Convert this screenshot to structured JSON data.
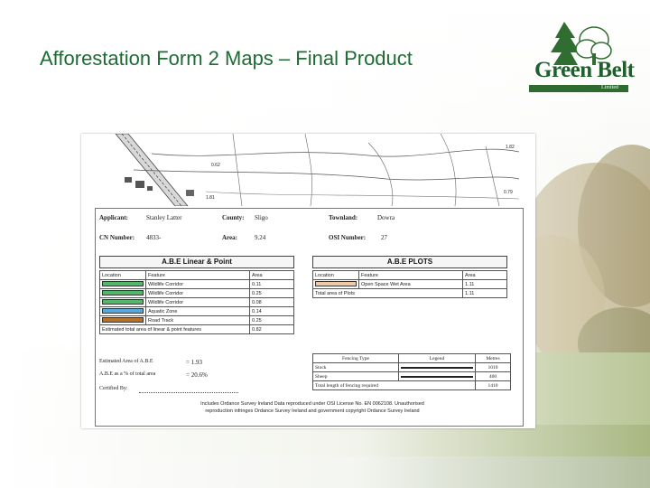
{
  "slide": {
    "title": "Afforestation Form 2 Maps – Final Product"
  },
  "logo": {
    "name": "Green Belt",
    "limited": "Limited",
    "icon": "tree-icon"
  },
  "map": {
    "labels": [
      "1.82",
      "1.81",
      "0.79",
      "0.62"
    ]
  },
  "applicant": {
    "applicant_label": "Applicant:",
    "applicant_value": "Stanley Latter",
    "county_label": "County:",
    "county_value": "Sligo",
    "townland_label": "Townland:",
    "townland_value": "Dowra",
    "cn_label": "CN Number:",
    "cn_value": "4833-",
    "area_label": "Area:",
    "area_value": "9.24",
    "osi_label": "OSI Number:",
    "osi_value": "27"
  },
  "abe_linear": {
    "heading": "A.B.E Linear & Point",
    "columns": [
      "Location",
      "Feature",
      "Area"
    ],
    "rows": [
      {
        "color": "#4fb869",
        "feature": "Wildlife Corridor",
        "area": "0.11"
      },
      {
        "color": "#4fb869",
        "feature": "Wildlife Corridor",
        "area": "0.25"
      },
      {
        "color": "#4fb869",
        "feature": "Wildlife Corridor",
        "area": "0.08"
      },
      {
        "color": "#55a9de",
        "feature": "Aquatic Zone",
        "area": "0.14"
      },
      {
        "color": "#b5722a",
        "feature": "Road Track",
        "area": "0.25"
      }
    ],
    "total_label": "Estimated total area of linear & point features",
    "total_value": "0.82"
  },
  "abe_plots": {
    "heading": "A.B.E PLOTS",
    "columns": [
      "Location",
      "Feature",
      "Area"
    ],
    "rows": [
      {
        "color": "#f0caa6",
        "feature": "Open Space Wet Area",
        "area": "1.11"
      }
    ],
    "total_label": "Total area of Plots",
    "total_value": "1.11"
  },
  "estimates": {
    "est_label": "Estimated Area of A.B.E",
    "est_value": "= 1.93",
    "pct_label": "A.B.E as a % of total area",
    "pct_value": "= 20.6%",
    "cert_label": "Certified By:"
  },
  "fencing": {
    "columns": [
      "Fencing Type",
      "Legend",
      "Metres"
    ],
    "rows": [
      {
        "type": "Stock",
        "metres": "1010"
      },
      {
        "type": "Sheep",
        "metres": "400"
      }
    ],
    "total_label": "Total length of fencing required",
    "total_value": "1410"
  },
  "footer_note": {
    "line1": "Includes Ordance Survey Ireland Data reproduced under OSI License No. EN 0062108. Unauthorised",
    "line2": "reproduction infringes Ordance Survey Ireland and government copyright Ordance Survey Ireland"
  }
}
